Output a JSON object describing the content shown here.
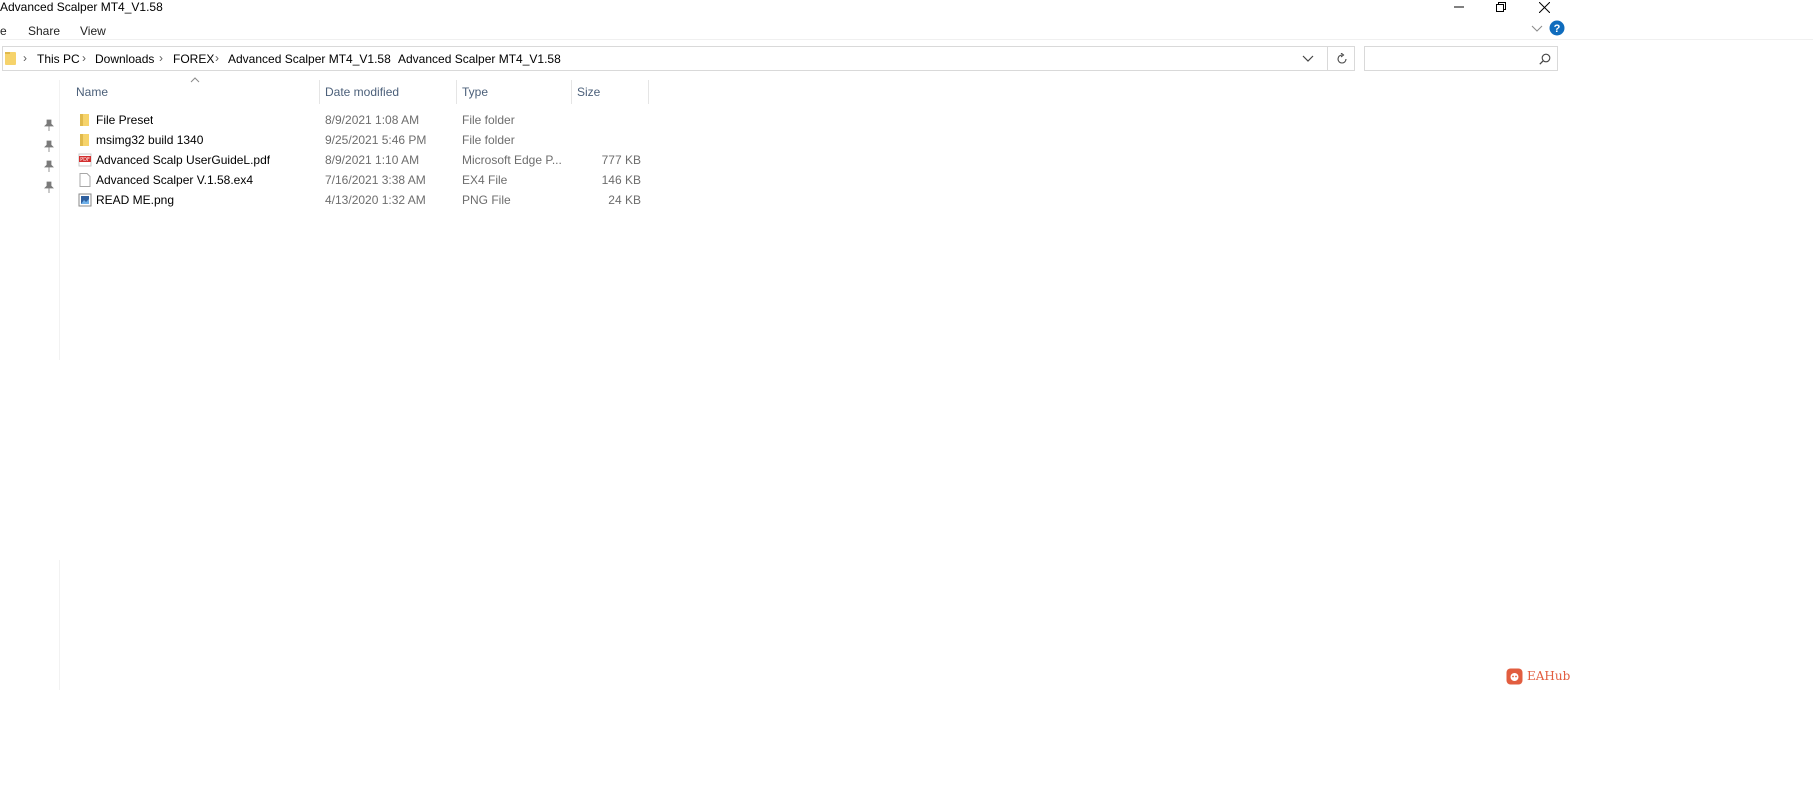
{
  "window": {
    "title": "Advanced Scalper MT4_V1.58"
  },
  "ribbon": {
    "tabs": [
      "e",
      "Share",
      "View"
    ]
  },
  "address": {
    "crumbs": [
      "This PC",
      "Downloads",
      "FOREX",
      "Advanced Scalper MT4_V1.58",
      "Advanced Scalper MT4_V1.58"
    ],
    "search_placeholder": ""
  },
  "columns": {
    "name": "Name",
    "date": "Date modified",
    "type": "Type",
    "size": "Size"
  },
  "files": [
    {
      "name": "File Preset",
      "date": "8/9/2021 1:08 AM",
      "type": "File folder",
      "size": "",
      "icon": "folder-icon"
    },
    {
      "name": "msimg32 build 1340",
      "date": "9/25/2021 5:46 PM",
      "type": "File folder",
      "size": "",
      "icon": "folder-icon"
    },
    {
      "name": "Advanced Scalp UserGuideL.pdf",
      "date": "8/9/2021 1:10 AM",
      "type": "Microsoft Edge P...",
      "size": "777 KB",
      "icon": "pdf-icon"
    },
    {
      "name": "Advanced Scalper V.1.58.ex4",
      "date": "7/16/2021 3:38 AM",
      "type": "EX4 File",
      "size": "146 KB",
      "icon": "file-icon"
    },
    {
      "name": "READ ME.png",
      "date": "4/13/2020 1:32 AM",
      "type": "PNG File",
      "size": "24 KB",
      "icon": "image-icon"
    }
  ],
  "watermark": {
    "text": "EAHub"
  },
  "colors": {
    "folder": "#f6d36b",
    "accent": "#0f6cbd",
    "header_text": "#4c607a",
    "watermark": "#e25d3f"
  }
}
